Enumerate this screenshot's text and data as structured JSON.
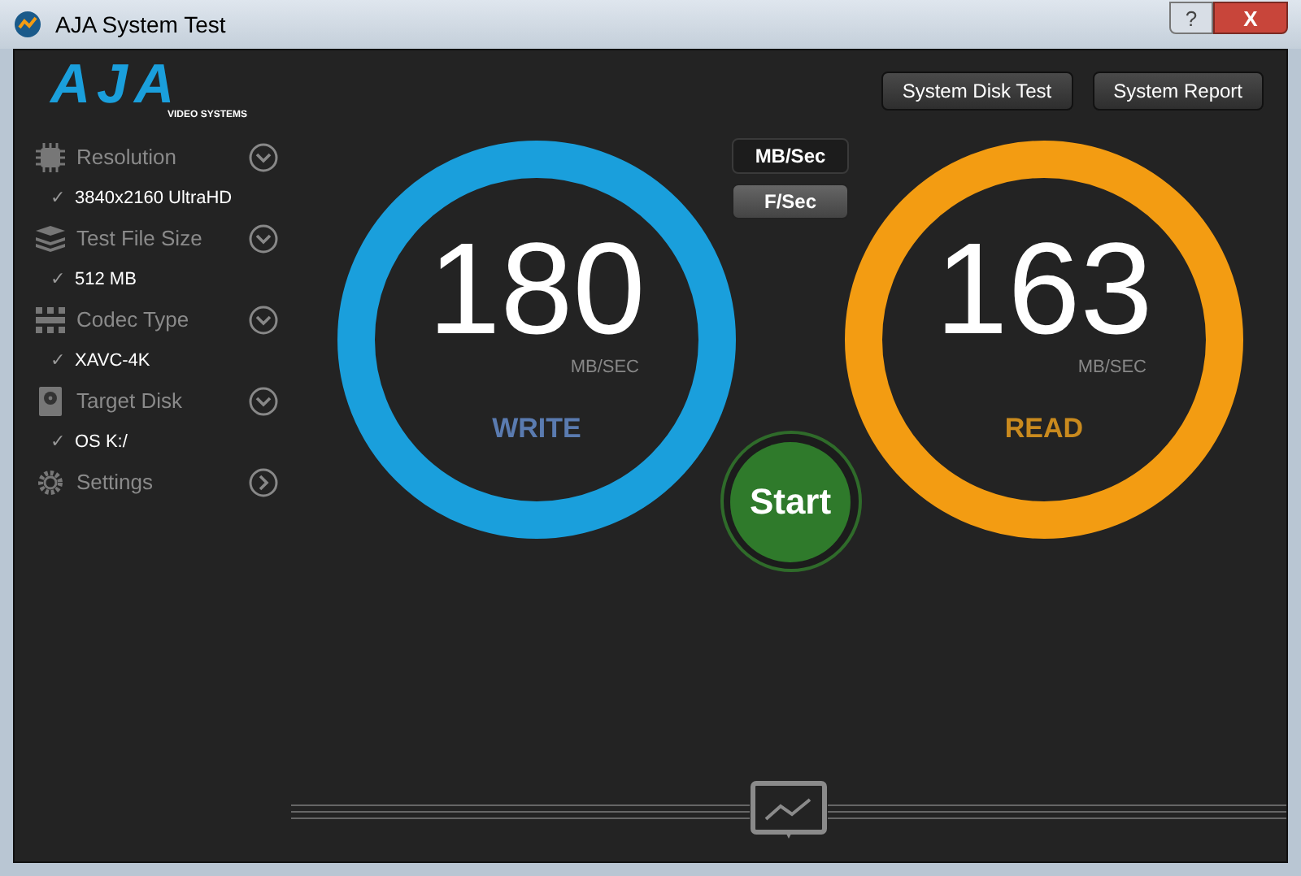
{
  "window": {
    "title": "AJA System Test",
    "help": "?",
    "close": "X"
  },
  "logo": {
    "name": "AJA",
    "tagline": "VIDEO SYSTEMS"
  },
  "settings": [
    {
      "kind": "dropdown",
      "label": "Resolution",
      "check": "✓",
      "value": "3840x2160 UltraHD"
    },
    {
      "kind": "dropdown",
      "label": "Test File Size",
      "check": "✓",
      "value": "512 MB"
    },
    {
      "kind": "dropdown",
      "label": "Codec Type",
      "check": "✓",
      "value": "XAVC-4K"
    },
    {
      "kind": "dropdown",
      "label": "Target Disk",
      "check": "✓",
      "value": "OS K:/"
    },
    {
      "kind": "link",
      "label": "Settings"
    }
  ],
  "top_buttons": [
    "System Disk Test",
    "System Report"
  ],
  "units": [
    {
      "label": "MB/Sec",
      "selected": true
    },
    {
      "label": "F/Sec",
      "selected": false
    }
  ],
  "gauges": [
    {
      "kind": "write",
      "value": "180",
      "unit": "MB/SEC",
      "label": "WRITE",
      "color": "#1a9fdc"
    },
    {
      "kind": "read",
      "value": "163",
      "unit": "MB/SEC",
      "label": "READ",
      "color": "#f39c12"
    }
  ],
  "start_button": "Start"
}
